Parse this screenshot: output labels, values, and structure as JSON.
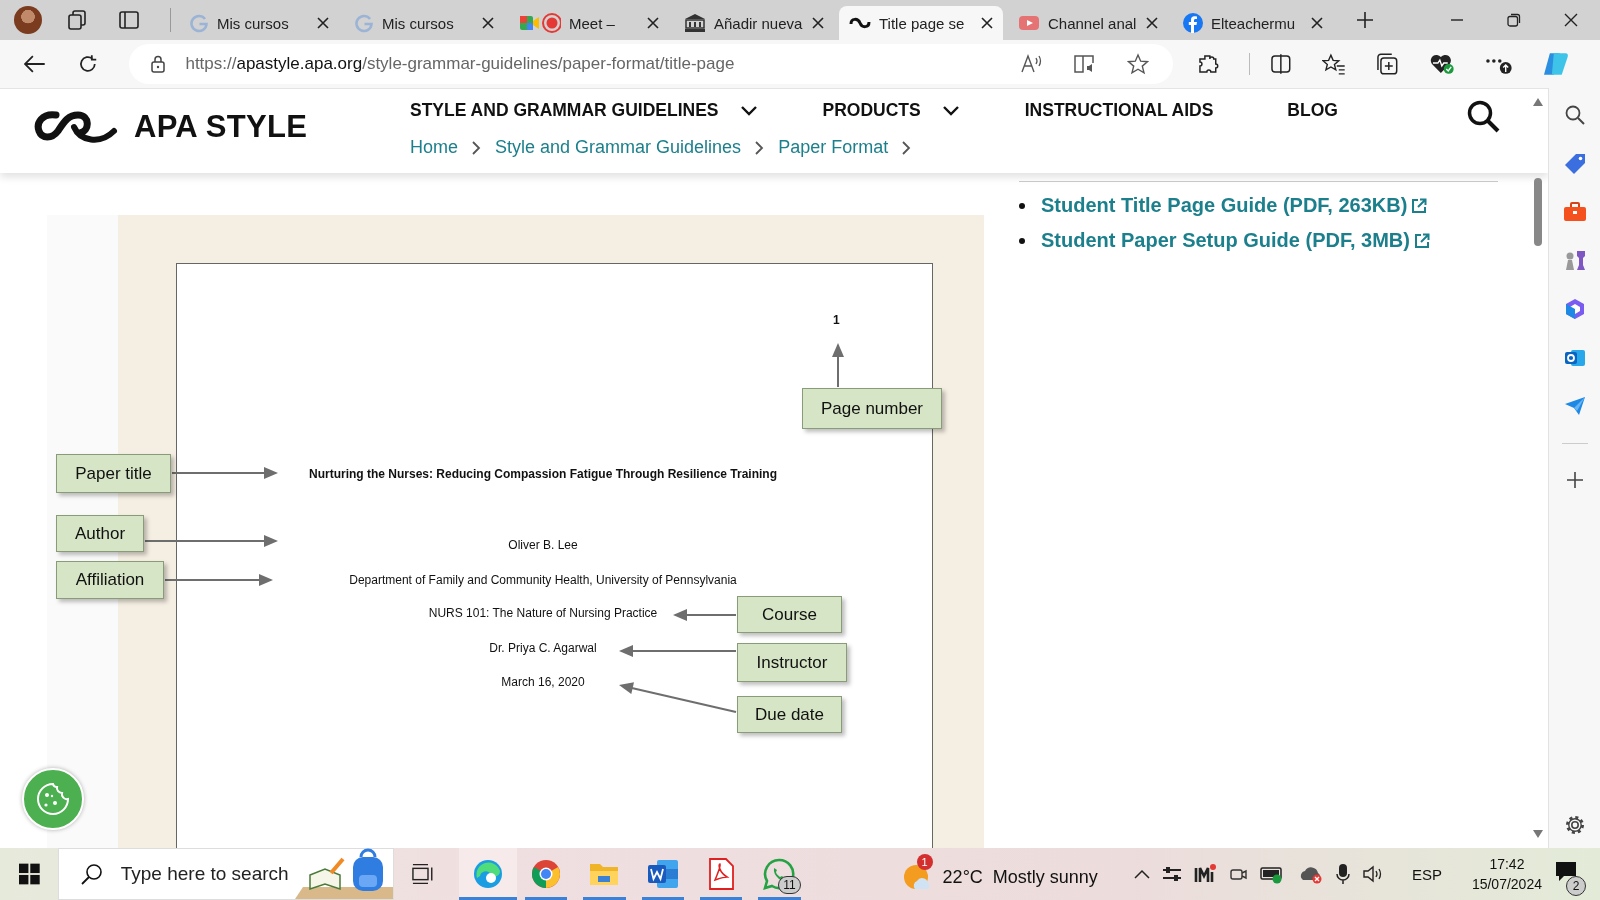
{
  "browser": {
    "tabs": [
      {
        "kind": "google",
        "title": "Mis cursos",
        "selected": false
      },
      {
        "kind": "google",
        "title": "Mis cursos",
        "selected": false
      },
      {
        "kind": "meet",
        "title": "Meet –",
        "selected": false
      },
      {
        "kind": "etm",
        "title": "Añadir nueva",
        "selected": false
      },
      {
        "kind": "apa",
        "title": "Title page se",
        "selected": true
      },
      {
        "kind": "youtube",
        "title": "Channel anal",
        "selected": false
      },
      {
        "kind": "facebook",
        "title": "Elteachermu",
        "selected": false
      }
    ],
    "address": {
      "scheme": "https://",
      "host": "apastyle.apa.org",
      "path": "/style-grammar-guidelines/paper-format/title-page"
    }
  },
  "header": {
    "logo": "APA STYLE",
    "nav": [
      {
        "label": "STYLE AND GRAMMAR GUIDELINES",
        "has_menu": true
      },
      {
        "label": "PRODUCTS",
        "has_menu": true
      },
      {
        "label": "INSTRUCTIONAL AIDS",
        "has_menu": false
      },
      {
        "label": "BLOG",
        "has_menu": false
      }
    ],
    "breadcrumbs": [
      "Home",
      "Style and Grammar Guidelines",
      "Paper Format"
    ]
  },
  "figure": {
    "page_number": "1",
    "lines": [
      {
        "kind": "title",
        "text": "Nurturing the Nurses: Reducing Compassion Fatigue Through Resilience Training"
      },
      {
        "kind": "author",
        "text": "Oliver B. Lee"
      },
      {
        "kind": "affiliation",
        "text": "Department of Family and Community Health, University of Pennsylvania"
      },
      {
        "kind": "course",
        "text": "NURS 101: The Nature of Nursing Practice"
      },
      {
        "kind": "instructor",
        "text": "Dr. Priya C. Agarwal"
      },
      {
        "kind": "due_date",
        "text": "March 16, 2020"
      }
    ],
    "labels": [
      {
        "kind": "page_number",
        "text": "Page number"
      },
      {
        "kind": "title",
        "text": "Paper title"
      },
      {
        "kind": "author",
        "text": "Author"
      },
      {
        "kind": "affiliation",
        "text": "Affiliation"
      },
      {
        "kind": "course",
        "text": "Course"
      },
      {
        "kind": "instructor",
        "text": "Instructor"
      },
      {
        "kind": "due_date",
        "text": "Due date"
      }
    ]
  },
  "links": [
    "Student Title Page Guide (PDF, 263KB)",
    "Student Paper Setup Guide (PDF, 3MB)"
  ],
  "taskbar": {
    "search_placeholder": "Type here to search",
    "apps": [
      {
        "kind": "edge",
        "running": true,
        "selected": true
      },
      {
        "kind": "chrome",
        "running": true,
        "selected": false
      },
      {
        "kind": "explorer",
        "running": true,
        "selected": false
      },
      {
        "kind": "word",
        "running": true,
        "selected": false
      },
      {
        "kind": "pdf",
        "running": true,
        "selected": false
      },
      {
        "kind": "whatsapp",
        "running": true,
        "selected": false,
        "badge": "11"
      }
    ],
    "weather": {
      "badge": "1",
      "temperature": "22°C",
      "condition": "Mostly sunny"
    },
    "language": "ESP",
    "time": "17:42",
    "date": "15/07/2024",
    "notifications": "2"
  }
}
